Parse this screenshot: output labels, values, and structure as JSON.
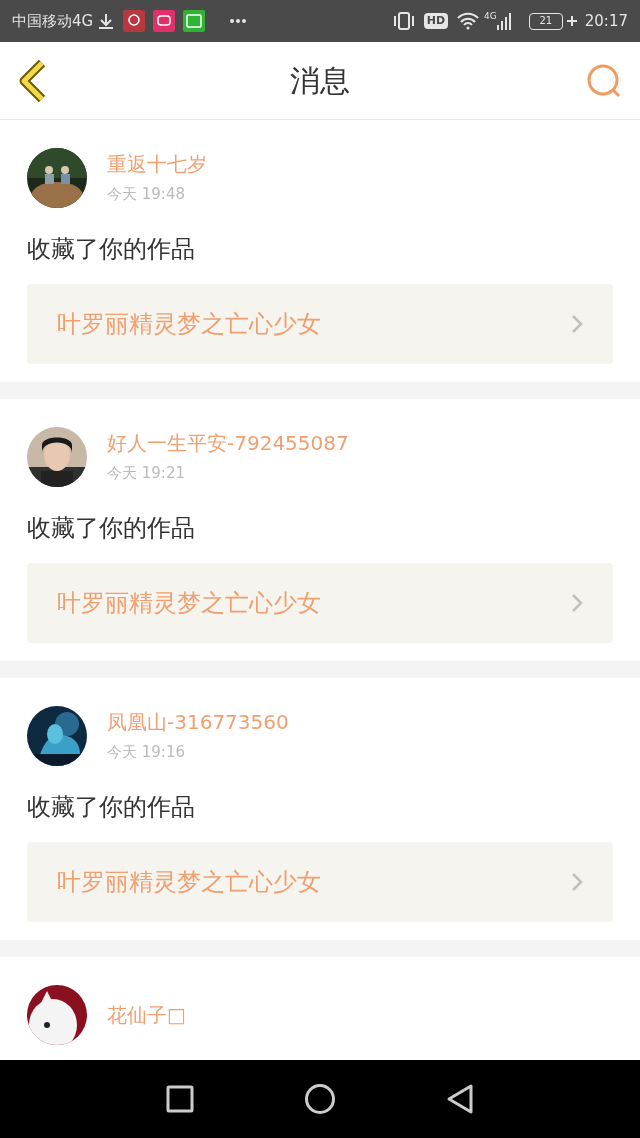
{
  "status_bar": {
    "carrier": "中国移动4G",
    "hd": "HD",
    "network": "4G",
    "battery": "21",
    "time": "20:17"
  },
  "header": {
    "title": "消息"
  },
  "messages": [
    {
      "name": "重返十七岁",
      "time": "今天 19:48",
      "action": "收藏了你的作品",
      "work": "叶罗丽精灵梦之亡心少女"
    },
    {
      "name": "好人一生平安-792455087",
      "time": "今天 19:21",
      "action": "收藏了你的作品",
      "work": "叶罗丽精灵梦之亡心少女"
    },
    {
      "name": "凤凰山-316773560",
      "time": "今天 19:16",
      "action": "收藏了你的作品",
      "work": "叶罗丽精灵梦之亡心少女"
    },
    {
      "name": "花仙子□"
    }
  ]
}
